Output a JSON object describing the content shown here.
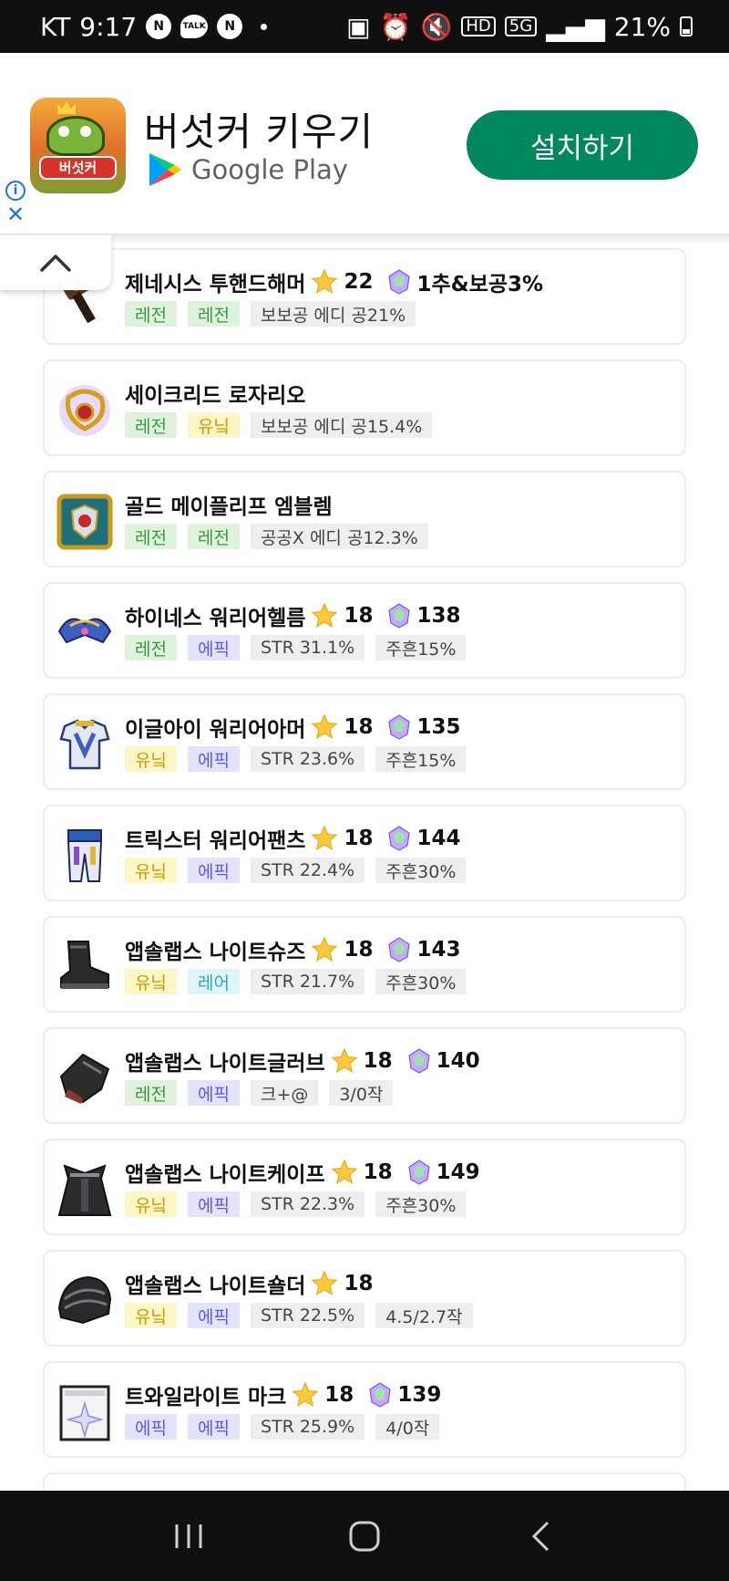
{
  "status_bar": {
    "carrier": "KT",
    "time": "9:17",
    "talk": "TALK",
    "n_badge": "N",
    "hd": "HD",
    "network": "5G",
    "battery": "21%"
  },
  "ad": {
    "app_name": "버섯커 키우기",
    "icon_logo": "버섯커",
    "store": "Google Play",
    "install_label": "설치하기",
    "info": "i",
    "close": "X"
  },
  "items": [
    {
      "name": "제네시스 투핸드해머",
      "star": "22",
      "potential": "1추&보공3%",
      "icon": "two-handed-hammer-icon",
      "tags": [
        {
          "label": "레전",
          "kind": "legend"
        },
        {
          "label": "레전",
          "kind": "legend"
        },
        {
          "label": "보보공 에디 공21%",
          "kind": "stat"
        }
      ]
    },
    {
      "name": "세이크리드 로자리오",
      "star": "",
      "potential": "",
      "icon": "rosary-icon",
      "tags": [
        {
          "label": "레전",
          "kind": "legend"
        },
        {
          "label": "유닠",
          "kind": "unique"
        },
        {
          "label": "보보공 에디 공15.4%",
          "kind": "stat"
        }
      ]
    },
    {
      "name": "골드 메이플리프 엠블렘",
      "star": "",
      "potential": "",
      "icon": "emblem-icon",
      "tags": [
        {
          "label": "레전",
          "kind": "legend"
        },
        {
          "label": "레전",
          "kind": "legend"
        },
        {
          "label": "공공X 에디 공12.3%",
          "kind": "stat"
        }
      ]
    },
    {
      "name": "하이네스 워리어헬름",
      "star": "18",
      "potential": "138",
      "icon": "helmet-icon",
      "tags": [
        {
          "label": "레전",
          "kind": "legend"
        },
        {
          "label": "에픽",
          "kind": "epic"
        },
        {
          "label": "STR 31.1%",
          "kind": "stat"
        },
        {
          "label": "주흔15%",
          "kind": "stat"
        }
      ]
    },
    {
      "name": "이글아이 워리어아머",
      "star": "18",
      "potential": "135",
      "icon": "armor-icon",
      "tags": [
        {
          "label": "유닠",
          "kind": "unique"
        },
        {
          "label": "에픽",
          "kind": "epic"
        },
        {
          "label": "STR 23.6%",
          "kind": "stat"
        },
        {
          "label": "주흔15%",
          "kind": "stat"
        }
      ]
    },
    {
      "name": "트릭스터 워리어팬츠",
      "star": "18",
      "potential": "144",
      "icon": "pants-icon",
      "tags": [
        {
          "label": "유닠",
          "kind": "unique"
        },
        {
          "label": "에픽",
          "kind": "epic"
        },
        {
          "label": "STR 22.4%",
          "kind": "stat"
        },
        {
          "label": "주흔30%",
          "kind": "stat"
        }
      ]
    },
    {
      "name": "앱솔랩스 나이트슈즈",
      "star": "18",
      "potential": "143",
      "icon": "shoes-icon",
      "tags": [
        {
          "label": "유닠",
          "kind": "unique"
        },
        {
          "label": "레어",
          "kind": "rare"
        },
        {
          "label": "STR 21.7%",
          "kind": "stat"
        },
        {
          "label": "주흔30%",
          "kind": "stat"
        }
      ]
    },
    {
      "name": "앱솔랩스 나이트글러브",
      "star": "18",
      "potential": "140",
      "icon": "gloves-icon",
      "tags": [
        {
          "label": "레전",
          "kind": "legend"
        },
        {
          "label": "에픽",
          "kind": "epic"
        },
        {
          "label": "크+@",
          "kind": "stat"
        },
        {
          "label": "3/0작",
          "kind": "stat"
        }
      ]
    },
    {
      "name": "앱솔랩스 나이트케이프",
      "star": "18",
      "potential": "149",
      "icon": "cape-icon",
      "tags": [
        {
          "label": "유닠",
          "kind": "unique"
        },
        {
          "label": "에픽",
          "kind": "epic"
        },
        {
          "label": "STR 22.3%",
          "kind": "stat"
        },
        {
          "label": "주흔30%",
          "kind": "stat"
        }
      ]
    },
    {
      "name": "앱솔랩스 나이트숄더",
      "star": "18",
      "potential": "",
      "icon": "shoulder-icon",
      "tags": [
        {
          "label": "유닠",
          "kind": "unique"
        },
        {
          "label": "에픽",
          "kind": "epic"
        },
        {
          "label": "STR 22.5%",
          "kind": "stat"
        },
        {
          "label": "4.5/2.7작",
          "kind": "stat"
        }
      ]
    },
    {
      "name": "트와일라이트 마크",
      "star": "18",
      "potential": "139",
      "icon": "face-accessory-icon",
      "tags": [
        {
          "label": "에픽",
          "kind": "epic"
        },
        {
          "label": "에픽",
          "kind": "epic"
        },
        {
          "label": "STR 25.9%",
          "kind": "stat"
        },
        {
          "label": "4/0작",
          "kind": "stat"
        }
      ]
    }
  ],
  "colors": {
    "install_green": "#01875f",
    "legend": "#3a9a3a",
    "unique": "#c89c00",
    "epic": "#5b5be6",
    "rare": "#2ea6c8"
  }
}
